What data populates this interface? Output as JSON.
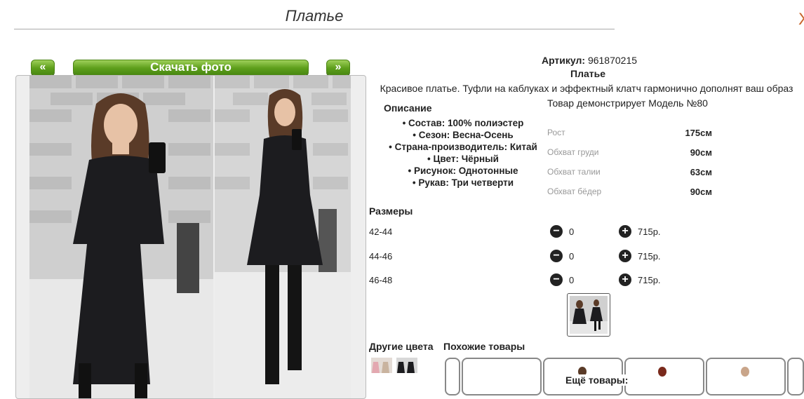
{
  "page": {
    "title": "Платье",
    "close_glyph": "Х"
  },
  "gallery": {
    "prev_label": "«",
    "download_label": "Скачать фото",
    "next_label": "»"
  },
  "product": {
    "article_label": "Артикул:",
    "article_value": "961870215",
    "name": "Платье",
    "description": "Красивое платье. Туфли на каблуках и эффектный клатч гармонично дополнят ваш образ",
    "model_note": "Товар демонстрирует Модель №80",
    "description_heading": "Описание",
    "specs": [
      "Состав: 100% полиэстер",
      "Сезон: Весна-Осень",
      "Страна-производитель: Китай",
      "Цвет: Чёрный",
      "Рисунок: Однотонные",
      "Рукав: Три четверти"
    ]
  },
  "measurements": [
    {
      "label": "Рост",
      "value": "175см"
    },
    {
      "label": "Обхват груди",
      "value": "90см"
    },
    {
      "label": "Обхват талии",
      "value": "63см"
    },
    {
      "label": "Обхват бёдер",
      "value": "90см"
    }
  ],
  "sizes": {
    "heading": "Размеры",
    "minus_glyph": "−",
    "plus_glyph": "+",
    "rows": [
      {
        "size": "42-44",
        "qty": "0",
        "price": "715р."
      },
      {
        "size": "44-46",
        "qty": "0",
        "price": "715р."
      },
      {
        "size": "46-48",
        "qty": "0",
        "price": "715р."
      }
    ]
  },
  "related": {
    "other_colors_heading": "Другие цвета",
    "similar_heading": "Похожие товары",
    "more_goods_label": "Ещё товары:"
  },
  "colors": {
    "accent_green": "#5e9f1c",
    "text": "#222222",
    "muted": "#999999"
  },
  "icons": [
    "minus-circle-icon",
    "plus-circle-icon"
  ]
}
